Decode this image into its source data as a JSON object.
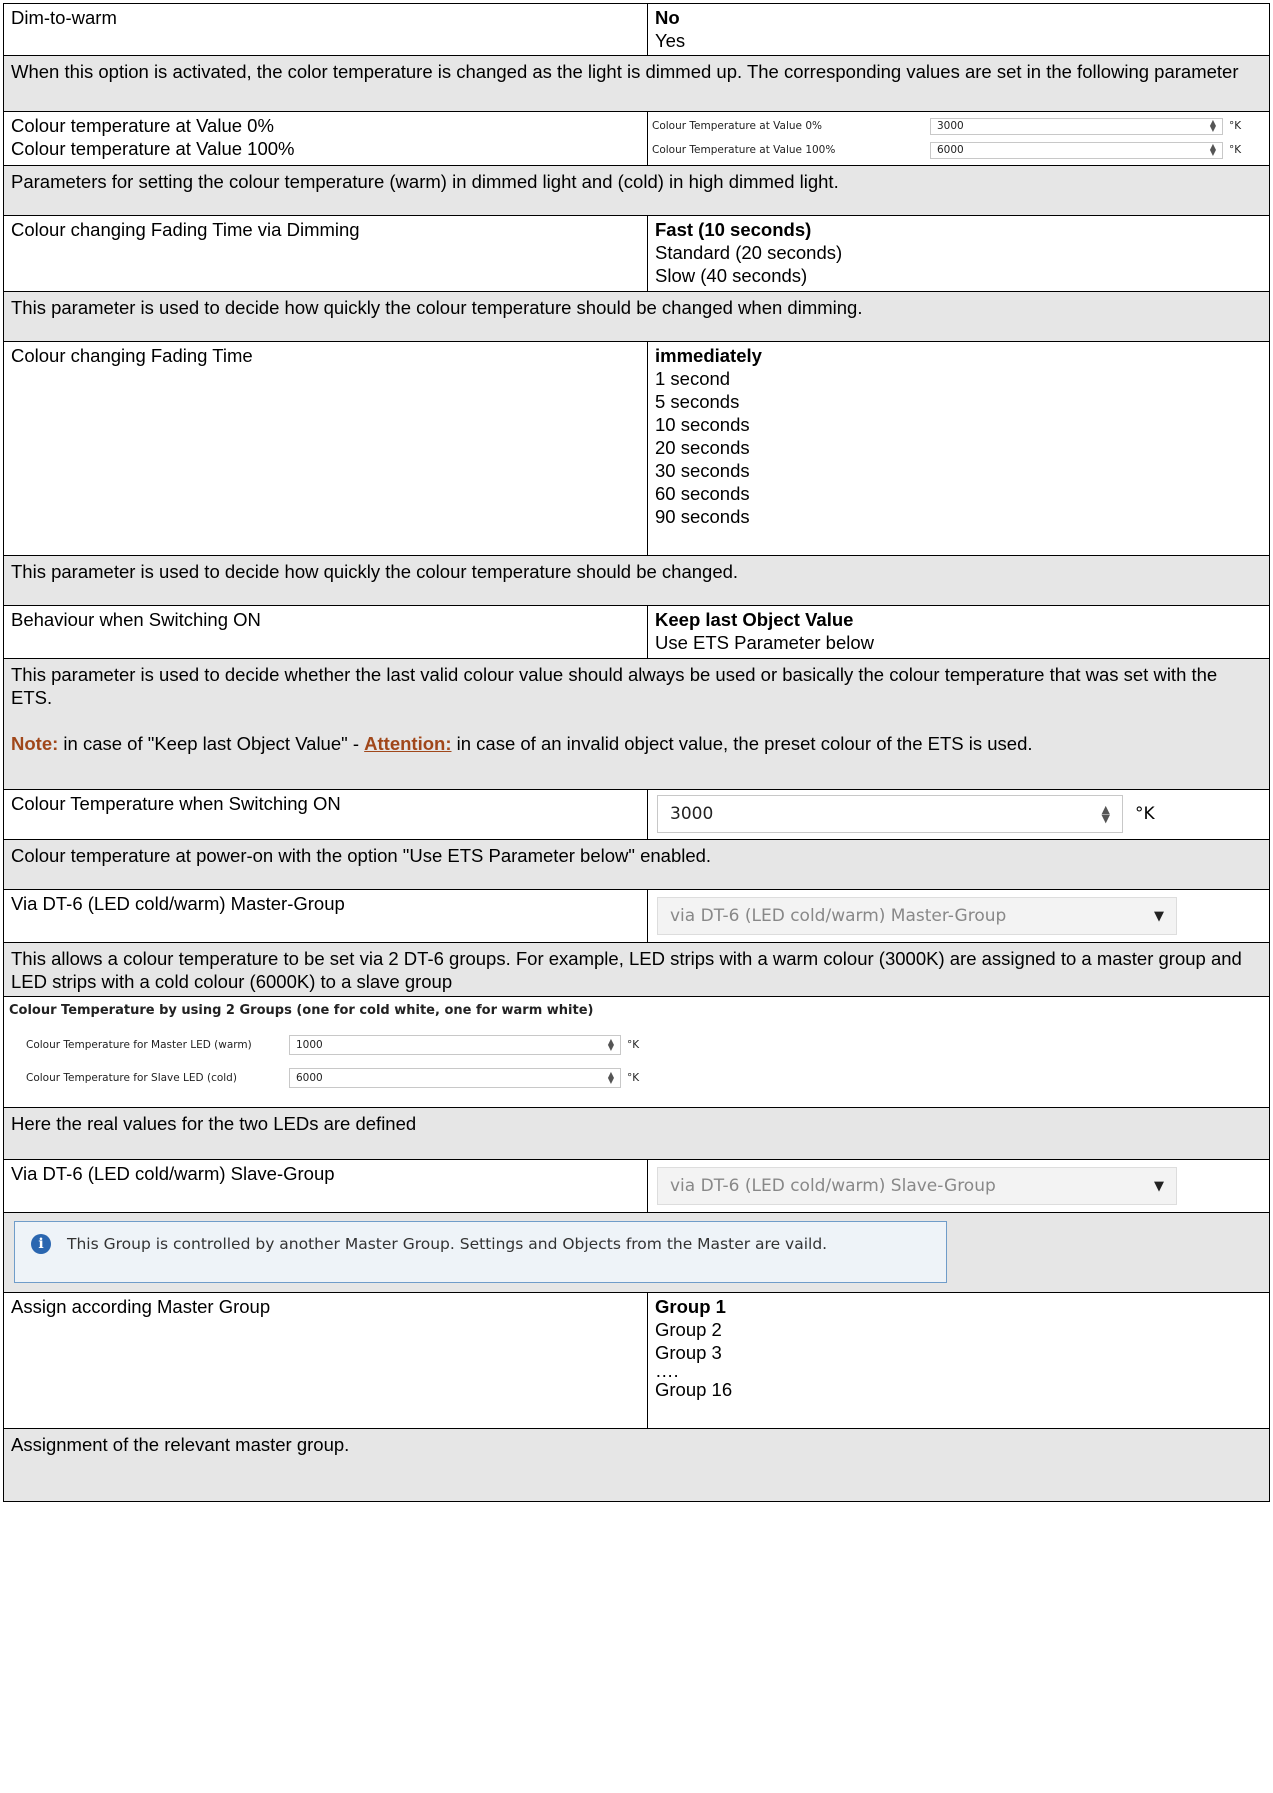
{
  "rows": {
    "r1": {
      "label": "Dim-to-warm",
      "options": [
        "No",
        "Yes"
      ],
      "desc": "When this option is activated, the color temperature is changed as the light is dimmed up. The corresponding values are set in the following parameter"
    },
    "r2": {
      "label1": "Colour temperature at Value 0%",
      "label2": "Colour temperature at Value 100%",
      "fields": [
        {
          "label": "Colour Temperature at Value 0%",
          "value": "3000",
          "unit": "°K"
        },
        {
          "label": "Colour Temperature at Value 100%",
          "value": "6000",
          "unit": "°K"
        }
      ],
      "desc": "Parameters for setting the colour temperature (warm) in dimmed light and (cold) in high dimmed light."
    },
    "r3": {
      "label": "Colour changing Fading Time via Dimming",
      "options": [
        "Fast (10 seconds)",
        "Standard (20 seconds)",
        "Slow (40 seconds)"
      ],
      "desc": "This parameter is used to decide how quickly the colour temperature should be changed when dimming."
    },
    "r4": {
      "label": "Colour changing Fading Time",
      "options": [
        "immediately",
        "1 second",
        "5 seconds",
        "10 seconds",
        "20 seconds",
        "30 seconds",
        "60 seconds",
        "90 seconds"
      ],
      "desc": "This parameter is used to decide how quickly the colour temperature should be changed."
    },
    "r5": {
      "label": "Behaviour when Switching ON",
      "options": [
        "Keep last Object Value",
        "Use ETS Parameter below"
      ],
      "desc": "This parameter is used to decide whether the last valid colour value should always be used or basically the colour temperature that was set with the ETS.",
      "note_label": "Note:",
      "note_a": " in case of \"Keep last Object Value\" - ",
      "note_attn": "Attention:",
      "note_b": " in case of an invalid object value, the preset colour of the ETS is used."
    },
    "r6": {
      "label": "Colour Temperature when Switching ON",
      "value": "3000",
      "unit": "°K",
      "desc": "Colour temperature at power-on with the option \"Use ETS Parameter below\" enabled."
    },
    "r7": {
      "label": "Via DT-6 (LED cold/warm) Master-Group",
      "select": "via DT-6 (LED cold/warm) Master-Group",
      "desc": "This allows a colour temperature to be set via 2 DT-6 groups. For example, LED strips with a warm colour (3000K) are assigned to a master group and LED strips with a cold colour (6000K) to a slave group"
    },
    "panel": {
      "title": "Colour Temperature by using 2 Groups (one for cold white, one for warm white)",
      "fields": [
        {
          "label": "Colour Temperature for Master LED (warm)",
          "value": "1000",
          "unit": "°K"
        },
        {
          "label": "Colour Temperature for Slave LED (cold)",
          "value": "6000",
          "unit": "°K"
        }
      ],
      "desc": "Here the real values for the two LEDs are defined"
    },
    "r8": {
      "label": "Via DT-6 (LED cold/warm) Slave-Group",
      "select": "via DT-6 (LED cold/warm) Slave-Group",
      "info": "This Group is controlled by another Master Group. Settings and Objects from the Master are vaild."
    },
    "r9": {
      "label": "Assign according Master Group",
      "options": [
        "Group 1",
        "Group 2",
        "Group 3",
        "….",
        "Group 16"
      ],
      "desc": "Assignment of the relevant master group."
    }
  },
  "icons": {
    "info": "info-icon",
    "spin": "spinner-icon",
    "dropdown": "chevron-down-icon"
  },
  "colors": {
    "desc_bg": "#e6e6e6",
    "note": "#a0471a",
    "info_border": "#6f9cc9",
    "info_icon": "#2a66b0"
  }
}
